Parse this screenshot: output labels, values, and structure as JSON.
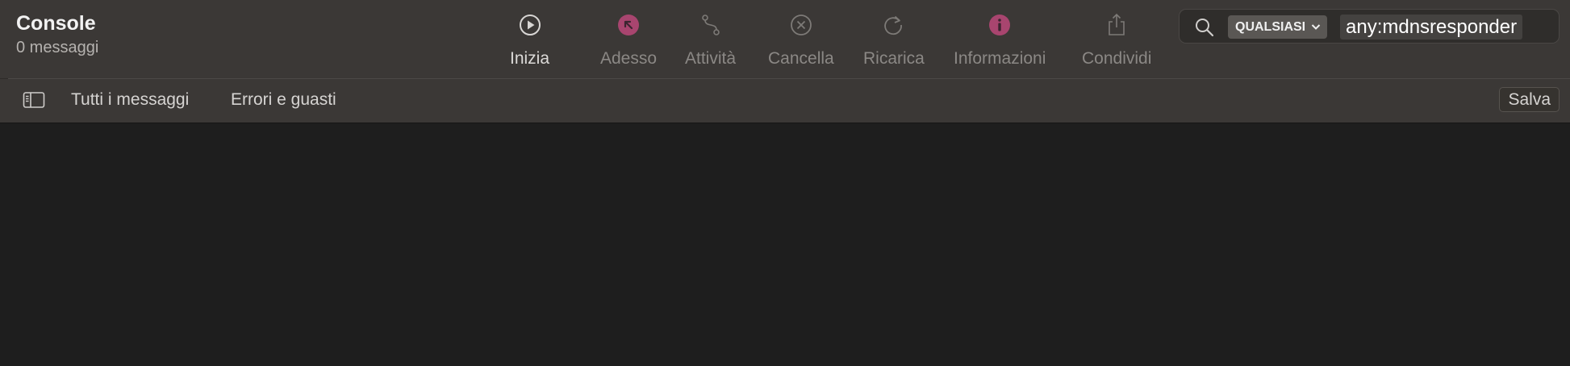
{
  "window": {
    "title": "Console",
    "subtitle": "0 messaggi"
  },
  "toolbar": {
    "items": [
      {
        "label": "Inizia",
        "icon": "play-circle-icon"
      },
      {
        "label": "Adesso",
        "icon": "arrow-up-left-circle-icon"
      },
      {
        "label": "Attività",
        "icon": "activity-path-icon"
      },
      {
        "label": "Cancella",
        "icon": "clear-x-circle-icon"
      },
      {
        "label": "Ricarica",
        "icon": "reload-icon"
      },
      {
        "label": "Informazioni",
        "icon": "info-circle-icon"
      },
      {
        "label": "Condividi",
        "icon": "share-icon"
      }
    ]
  },
  "search": {
    "icon": "search-icon",
    "token_label": "QUALSIASI",
    "value": "any:mdnsresponder"
  },
  "filterbar": {
    "sidebar_icon": "sidebar-toggle-icon",
    "favorites": [
      "Tutti i messaggi",
      "Errori e guasti"
    ],
    "save_label": "Salva"
  },
  "colors": {
    "toolbar_bg": "#3b3836",
    "content_bg": "#1e1e1e",
    "accent_pink": "#a8456f"
  }
}
